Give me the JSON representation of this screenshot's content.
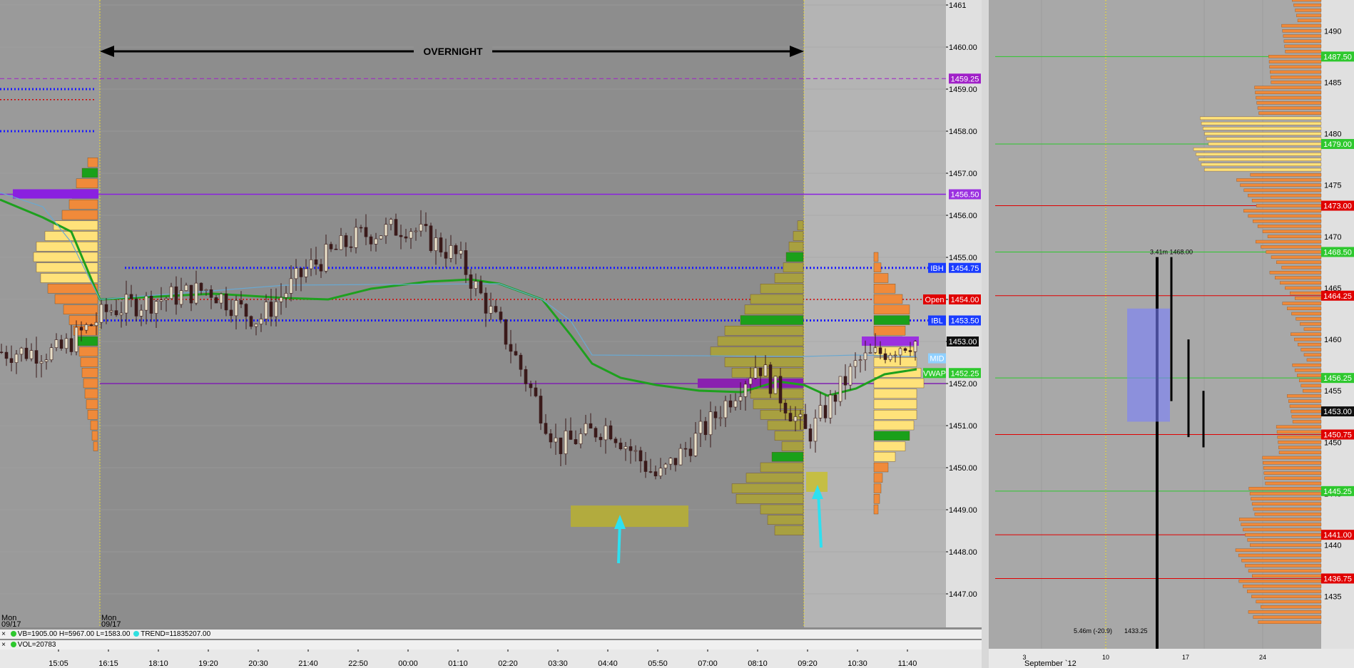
{
  "overnight_label": "OVERNIGHT",
  "left_chart": {
    "session_labels": [
      {
        "day": "Mon",
        "date": "09/17"
      },
      {
        "day": "Mon",
        "date": "09/17"
      }
    ],
    "price_labels": [
      "1461",
      "1460.00",
      "1459.00",
      "1458.00",
      "1457.00",
      "1456.00",
      "1455.00",
      "1454.00",
      "1453.00",
      "1452.00",
      "1451.00",
      "1450.00",
      "1449.00",
      "1448.00",
      "1447.00"
    ],
    "time_labels": [
      "15:05",
      "16:15",
      "18:10",
      "19:20",
      "20:30",
      "21:40",
      "22:50",
      "00:00",
      "01:10",
      "02:20",
      "03:30",
      "04:40",
      "05:50",
      "07:00",
      "08:10",
      "09:20",
      "10:30",
      "11:40"
    ],
    "tags": [
      {
        "text": "1459.25",
        "color": "#a020c8",
        "fg": "#ffffff"
      },
      {
        "text": "1456.50",
        "color": "#9b30e0",
        "fg": "#ffffff"
      },
      {
        "text": "IBH",
        "color": "#1a3cff",
        "fg": "#ffffff"
      },
      {
        "text": "1454.75",
        "color": "#1a3cff",
        "fg": "#ffffff"
      },
      {
        "text": "Open",
        "color": "#e00000",
        "fg": "#ffffff"
      },
      {
        "text": "1454.00",
        "color": "#e00000",
        "fg": "#ffffff"
      },
      {
        "text": "IBL",
        "color": "#1a3cff",
        "fg": "#ffffff"
      },
      {
        "text": "1453.50",
        "color": "#1a3cff",
        "fg": "#ffffff"
      },
      {
        "text": "1453.00",
        "color": "#101010",
        "fg": "#ffffff"
      },
      {
        "text": "MID",
        "color": "#8fd0ff",
        "fg": "#ffffff"
      },
      {
        "text": "VWAP",
        "color": "#2ec82e",
        "fg": "#ffffff"
      },
      {
        "text": "1452.25",
        "color": "#2ec82e",
        "fg": "#ffffff"
      }
    ],
    "indicator_rows": [
      {
        "prefix": "×",
        "parts": [
          {
            "dot": "#2ec82e",
            "text": "VB=1905.00 H=5967.00 L=1583.00"
          },
          {
            "dot": "#30e0e0",
            "text": "TREND=11835207.00"
          }
        ]
      },
      {
        "prefix": "×",
        "parts": [
          {
            "dot": "#2ec82e",
            "text": "VOL=20783"
          }
        ]
      }
    ]
  },
  "right_chart": {
    "price_labels": [
      "1490",
      "1485",
      "1480",
      "1475",
      "1470",
      "1465",
      "1460",
      "1455",
      "1450",
      "1445",
      "1440",
      "1435"
    ],
    "tags": [
      {
        "text": "1487.50",
        "color": "#2ec82e"
      },
      {
        "text": "1479.00",
        "color": "#2ec82e"
      },
      {
        "text": "1473.00",
        "color": "#e00000"
      },
      {
        "text": "1468.50",
        "color": "#2ec82e"
      },
      {
        "text": "1464.25",
        "color": "#e00000"
      },
      {
        "text": "1456.25",
        "color": "#2ec82e"
      },
      {
        "text": "1453.00",
        "color": "#101010"
      },
      {
        "text": "1450.75",
        "color": "#e00000"
      },
      {
        "text": "1445.25",
        "color": "#2ec82e"
      },
      {
        "text": "1441.00",
        "color": "#e00000"
      },
      {
        "text": "1436.75",
        "color": "#e00000"
      }
    ],
    "annotations": [
      "3.41m 1468.00",
      "5.46m (-20.9)",
      "1433.25"
    ],
    "time_labels": [
      "3",
      "September `12",
      "10",
      "17",
      "24"
    ]
  },
  "colors": {
    "overnight_bg": "#8d8d8d",
    "day_bg": "#b4b4b4",
    "candle": "#3a1a1a",
    "vwap": "#1ea01e",
    "ib_line": "#1a1aff",
    "open_line": "#d40000",
    "profile_orange": "#f08a3a",
    "profile_yellow": "#ffe27a",
    "overnight_profile": "#a8a040"
  },
  "chart_data": [
    {
      "type": "line",
      "title": "",
      "xlabel": "",
      "ylabel": "",
      "ylim": [
        1446.25,
        1461.25
      ],
      "x": [
        "15:05",
        "16:15",
        "18:10",
        "19:20",
        "20:30",
        "21:40",
        "22:50",
        "00:00",
        "01:10",
        "02:20",
        "03:30",
        "04:40",
        "05:50",
        "07:00",
        "08:10",
        "09:20",
        "10:30",
        "11:40"
      ],
      "series": [
        {
          "values": [
            1452.75,
            1453.75,
            1454.0,
            1454.25,
            1453.5,
            1454.75,
            1455.5,
            1455.75,
            1455.0,
            1453.0,
            1450.5,
            1451.0,
            1449.75,
            1451.0,
            1452.5,
            1450.75,
            1452.5,
            1453.0
          ]
        },
        {
          "values": [
            1455.5,
            1453.9,
            1453.95,
            1454.0,
            1454.05,
            1454.3,
            1454.45,
            1454.55,
            1454.6,
            1454.2,
            1452.8,
            1452.0,
            1451.9,
            1451.75,
            1451.95,
            1451.8,
            1451.85,
            1452.25
          ]
        }
      ],
      "horizontal_levels": [
        1459.25,
        1456.5,
        1454.75,
        1454.0,
        1453.5,
        1453.0,
        1452.25
      ]
    },
    {
      "type": "bar",
      "title": "",
      "xlabel": "",
      "ylabel": "",
      "ylim": [
        1432,
        1493
      ],
      "x": [
        "3",
        "10",
        "17",
        "24"
      ],
      "horizontal_levels": [
        1487.5,
        1479.0,
        1473.0,
        1468.5,
        1464.25,
        1456.25,
        1453.0,
        1450.75,
        1445.25,
        1441.0,
        1436.75
      ]
    }
  ]
}
